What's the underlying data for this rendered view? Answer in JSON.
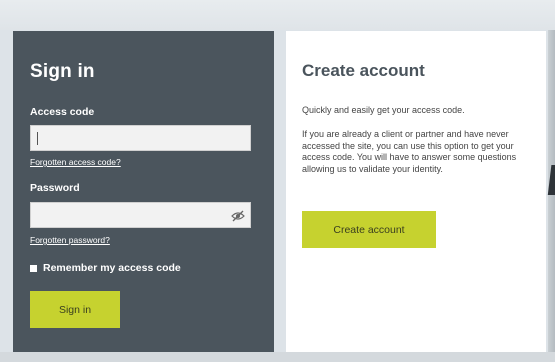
{
  "signin": {
    "title": "Sign in",
    "access_code_label": "Access code",
    "access_code_value": "",
    "forgot_access_code": "Forgotten access code?",
    "password_label": "Password",
    "password_value": "",
    "forgot_password": "Forgotten password?",
    "remember_label": "Remember my access code",
    "remember_checked": false,
    "button_label": "Sign in"
  },
  "create": {
    "title": "Create account",
    "paragraph1": "Quickly and easily get your access code.",
    "paragraph2": "If you are already a client or partner and have never accessed the site, you can use this option to get your access code. You will have to answer some questions allowing us to validate your identity.",
    "button_label": "Create account"
  },
  "colors": {
    "panel_dark": "#4b555d",
    "accent": "#c6d22f",
    "panel_light": "#ffffff"
  },
  "icons": {
    "password_toggle": "eye-slash-icon"
  }
}
